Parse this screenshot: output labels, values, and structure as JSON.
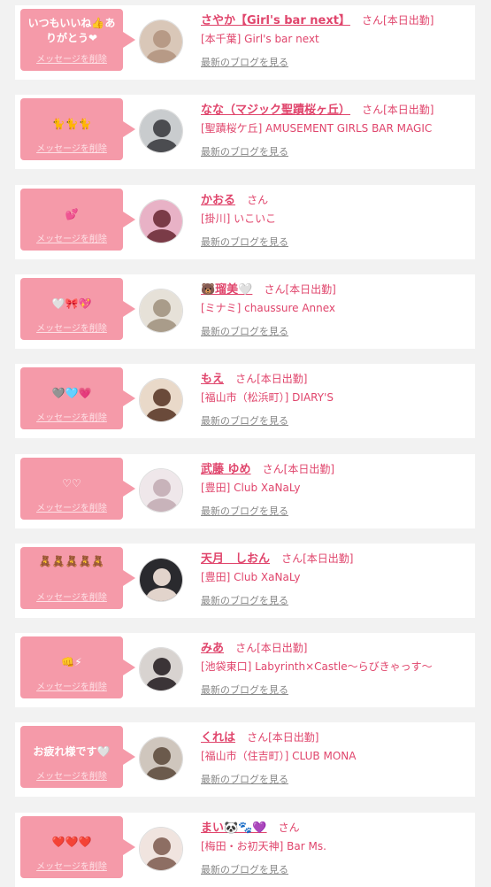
{
  "entries": [
    {
      "message": "いつもいいね👍ありがとう❤",
      "delete_label": "メッセージを削除",
      "name": "さやか【Girl's bar next】",
      "san": "さん",
      "today": "[本日出勤]",
      "shop": "[本千葉] Girl's bar next",
      "blog_label": "最新のブログを見る",
      "avatar_colors": [
        "#d9c7b8",
        "#b79a86"
      ]
    },
    {
      "message": "🐈🐈🐈",
      "delete_label": "メッセージを削除",
      "name": "なな（マジック聖蹟桜ヶ丘）",
      "san": "さん",
      "today": "[本日出勤]",
      "shop": "[聖蹟桜ケ丘] AMUSEMENT GIRLS BAR MAGIC",
      "blog_label": "最新のブログを見る",
      "avatar_colors": [
        "#c9ccce",
        "#4b4c50"
      ]
    },
    {
      "message": "💕",
      "delete_label": "メッセージを削除",
      "name": "かおる",
      "san": "さん",
      "today": "",
      "shop": "[掛川] いこいこ",
      "blog_label": "最新のブログを見る",
      "avatar_colors": [
        "#e8b2c6",
        "#7a3b47"
      ]
    },
    {
      "message": "🤍🎀💖",
      "delete_label": "メッセージを削除",
      "name": "🐻瑠美🤍",
      "san": "さん",
      "today": "[本日出勤]",
      "shop": "[ミナミ] chaussure Annex",
      "blog_label": "最新のブログを見る",
      "avatar_colors": [
        "#e6e1d8",
        "#a99c8a"
      ]
    },
    {
      "message": "🩶🩵💗",
      "delete_label": "メッセージを削除",
      "name": "もえ",
      "san": "さん",
      "today": "[本日出勤]",
      "shop": "[福山市（松浜町）] DIARY'S",
      "blog_label": "最新のブログを見る",
      "avatar_colors": [
        "#e9d9c9",
        "#6a4a3a"
      ]
    },
    {
      "message": "♡♡",
      "delete_label": "メッセージを削除",
      "name": "武藤 ゆめ",
      "san": "さん",
      "today": "[本日出勤]",
      "shop": "[豊田] Club XaNaLy",
      "blog_label": "最新のブログを見る",
      "avatar_colors": [
        "#efe7ea",
        "#c8b3ba"
      ]
    },
    {
      "message": "🧸🧸🧸🧸🧸",
      "delete_label": "メッセージを削除",
      "name": "天月　しおん",
      "san": "さん",
      "today": "[本日出勤]",
      "shop": "[豊田] Club XaNaLy",
      "blog_label": "最新のブログを見る",
      "avatar_colors": [
        "#2a2a2e",
        "#e2d4cc"
      ]
    },
    {
      "message": "👊⚡",
      "delete_label": "メッセージを削除",
      "name": "みあ",
      "san": "さん",
      "today": "[本日出勤]",
      "shop": "[池袋東口] Labyrinth×Castle～らびきゃっす～",
      "blog_label": "最新のブログを見る",
      "avatar_colors": [
        "#d8d3d0",
        "#3b3437"
      ]
    },
    {
      "message": "お疲れ様です🤍",
      "delete_label": "メッセージを削除",
      "name": "くれは",
      "san": "さん",
      "today": "[本日出勤]",
      "shop": "[福山市（住吉町）] CLUB MONA",
      "blog_label": "最新のブログを見る",
      "avatar_colors": [
        "#cfc6bd",
        "#6b5a4c"
      ]
    },
    {
      "message": "❤️❤️❤️",
      "delete_label": "メッセージを削除",
      "name": "まい🐼🐾💜",
      "san": "さん",
      "today": "",
      "shop": "[梅田・お初天神] Bar Ms.",
      "blog_label": "最新のブログを見る",
      "avatar_colors": [
        "#f0e4df",
        "#8d6e63"
      ]
    }
  ]
}
